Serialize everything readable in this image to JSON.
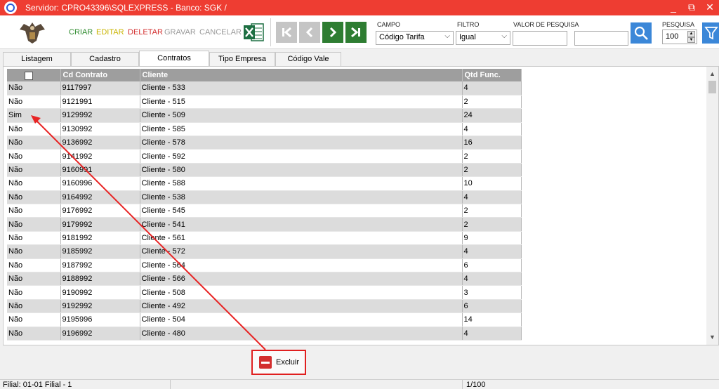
{
  "titlebar": {
    "title": "Servidor: CPRO43396\\SQLEXPRESS - Banco: SGK /",
    "minimize": "_",
    "restore": "⧉",
    "close": "✕"
  },
  "toolbar": {
    "criar": "CRIAR",
    "editar": "EDITAR",
    "deletar": "DELETAR",
    "gravar": "GRAVAR",
    "cancelar": "CANCELAR",
    "colors": {
      "criar": "#2e8b2e",
      "editar": "#c9b400",
      "deletar": "#d32f2f",
      "disabled": "#9a9a9a"
    }
  },
  "filters": {
    "campo_label": "CAMPO",
    "campo_value": "Código Tarifa",
    "filtro_label": "FILTRO",
    "filtro_value": "Igual",
    "valor_label": "VALOR DE PESQUISA",
    "valor_value": "",
    "valor2_value": "",
    "pesquisa_label": "PESQUISA",
    "pesquisa_value": "100"
  },
  "tabs": [
    "Listagem",
    "Cadastro",
    "Contratos",
    "Tipo Empresa",
    "Código Vale"
  ],
  "grid": {
    "columns": [
      "",
      "Cd Contrato",
      "Cliente",
      "Qtd Func."
    ],
    "rows": [
      [
        "Não",
        "9117997",
        "Cliente - 533",
        "4"
      ],
      [
        "Não",
        "9121991",
        "Cliente - 515",
        "2"
      ],
      [
        "Sim",
        "9129992",
        "Cliente - 509",
        "24"
      ],
      [
        "Não",
        "9130992",
        "Cliente - 585",
        "4"
      ],
      [
        "Não",
        "9136992",
        "Cliente - 578",
        "16"
      ],
      [
        "Não",
        "9141992",
        "Cliente - 592",
        "2"
      ],
      [
        "Não",
        "9160991",
        "Cliente - 580",
        "2"
      ],
      [
        "Não",
        "9160996",
        "Cliente - 588",
        "10"
      ],
      [
        "Não",
        "9164992",
        "Cliente - 538",
        "4"
      ],
      [
        "Não",
        "9176992",
        "Cliente - 545",
        "2"
      ],
      [
        "Não",
        "9179992",
        "Cliente - 541",
        "2"
      ],
      [
        "Não",
        "9181992",
        "Cliente - 561",
        "9"
      ],
      [
        "Não",
        "9185992",
        "Cliente - 572",
        "4"
      ],
      [
        "Não",
        "9187992",
        "Cliente - 564",
        "6"
      ],
      [
        "Não",
        "9188992",
        "Cliente - 566",
        "4"
      ],
      [
        "Não",
        "9190992",
        "Cliente - 508",
        "3"
      ],
      [
        "Não",
        "9192992",
        "Cliente - 492",
        "6"
      ],
      [
        "Não",
        "9195996",
        "Cliente - 504",
        "14"
      ],
      [
        "Não",
        "9196992",
        "Cliente - 480",
        "4"
      ]
    ]
  },
  "delete_button": {
    "label": "Excluir"
  },
  "status": {
    "filial": "Filial: 01-01 Filial - 1",
    "page": "1/100"
  },
  "annotation_color": "#e82424"
}
